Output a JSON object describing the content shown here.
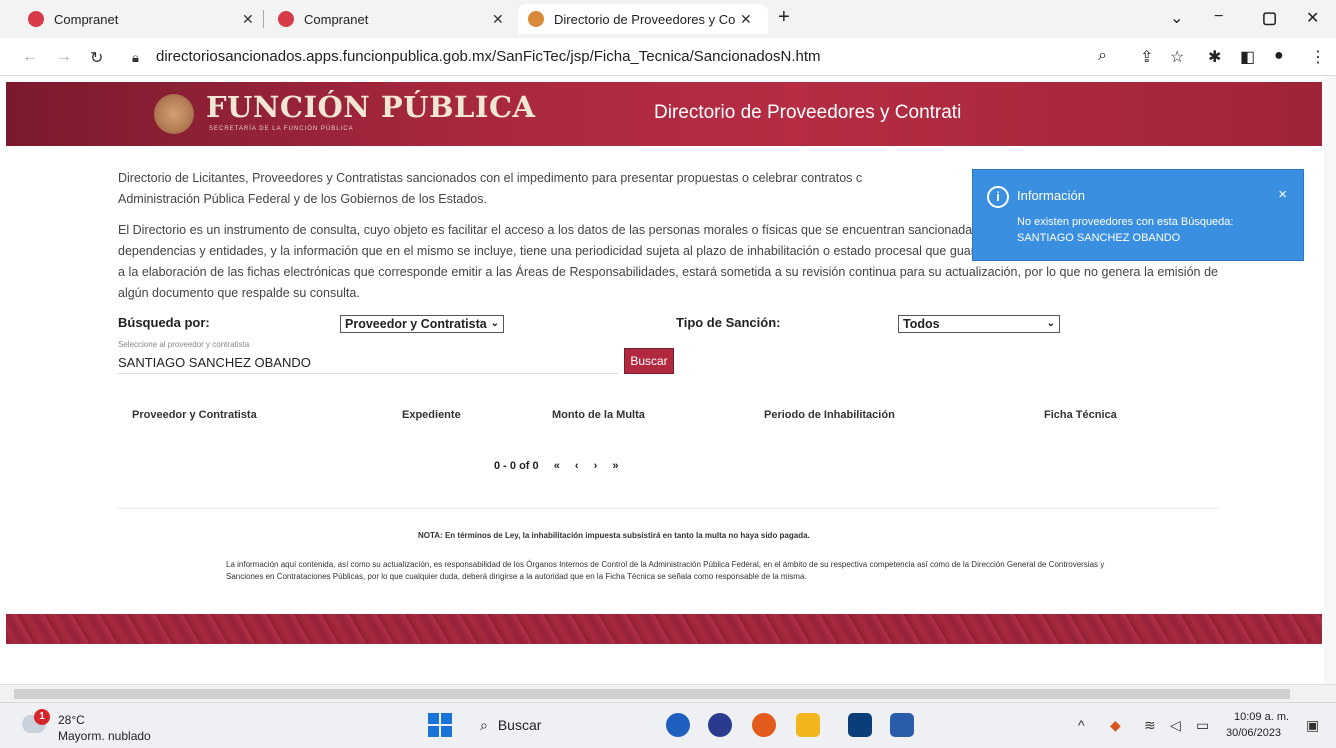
{
  "browser": {
    "tabs": [
      {
        "label": "Compranet",
        "icon": "compranet-favicon"
      },
      {
        "label": "Compranet",
        "icon": "compranet-favicon"
      },
      {
        "label": "Directorio de Proveedores y Co",
        "icon": "page-favicon"
      }
    ],
    "new_tab": "+",
    "url": "directoriosancionados.apps.funcionpublica.gob.mx/SanFicTec/jsp/Ficha_Tecnica/SancionadosN.htm"
  },
  "banner": {
    "logo_title": "FUNCIÓN PÚBLICA",
    "logo_subtitle": "SECRETARÍA DE LA FUNCIÓN PÚBLICA",
    "title": "Directorio de Proveedores y Contrati"
  },
  "intro": {
    "p1": "Directorio de Licitantes, Proveedores y Contratistas sancionados con el impedimento para presentar propuestas o celebrar contratos c",
    "p1b": "Administración Pública Federal y de los Gobiernos de los Estados.",
    "p2": "El Directorio es un instrumento de consulta, cuyo objeto es facilitar el acceso a los datos de las personas morales o físicas que se encuentran sancionadas por los Órganos Internos de Control en las dependencias y entidades, y la información que en el mismo se incluye, tiene una periodicidad sujeta al plazo de inhabilitación o estado procesal que guarde en caso de impugnación, aunque debido a la elaboración de las fichas electrónicas que corresponde emitir a las Áreas de Responsabilidades, estará sometida a su revisión continua para su actualización, por lo que no genera la emisión de algún documento que respalde su consulta."
  },
  "search": {
    "busqueda_label": "Búsqueda por:",
    "busqueda_value": "Proveedor y Contratista",
    "tipo_label": "Tipo de Sanción:",
    "tipo_value": "Todos",
    "hint": "Seleccione al proveedor y contratista",
    "name_value": "SANTIAGO SANCHEZ OBANDO",
    "buscar_label": "Buscar"
  },
  "table": {
    "columns": [
      "Proveedor y Contratista",
      "Expediente",
      "Monto de la Multa",
      "Periodo de Inhabilitación",
      "Ficha Técnica"
    ],
    "rows": []
  },
  "pager": {
    "range": "0 - 0 of 0",
    "first": "«",
    "prev": "‹",
    "next": "›",
    "last": "»"
  },
  "nota": "NOTA: En términos de Ley, la inhabilitación impuesta subsistirá en tanto la multa no haya sido pagada.",
  "legal": "La información aquí contenida, así como su actualización, es responsabilidad de los Órganos Internos de Control de la Administración Pública Federal, en el ámbito de su respectiva competencia así como de la Dirección General de Controversias y Sanciones en Contrataciones Públicas, por lo que cualquier duda, deberá dirigirse a la autoridad que en la Ficha Técnica se señala como responsable de la misma.",
  "toast": {
    "title": "Información",
    "message": "No existen proveedores con esta Búsqueda: SANTIAGO SANCHEZ OBANDO",
    "close": "×"
  },
  "taskbar": {
    "weather_temp": "28°C",
    "weather_desc": "Mayorm. nublado",
    "weather_badge": "1",
    "search_label": "Buscar",
    "time": "10:09 a. m.",
    "date": "30/06/2023"
  },
  "colors": {
    "brand": "#a8283e",
    "toast": "#3a8fe0"
  }
}
